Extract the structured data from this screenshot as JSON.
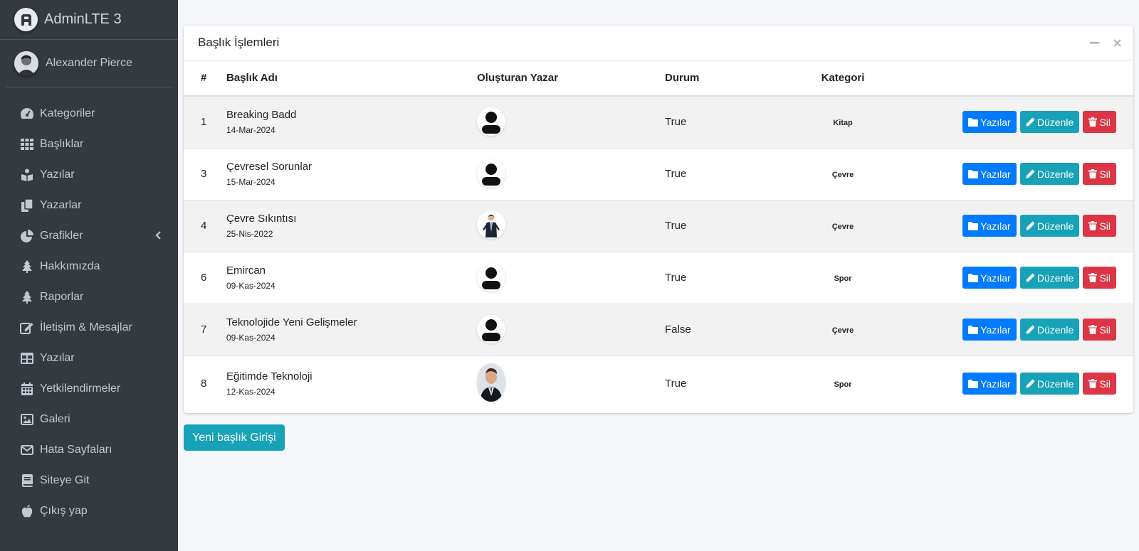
{
  "brand": {
    "name": "AdminLTE 3",
    "logo_icon": "adminlte-logo-icon"
  },
  "user": {
    "name": "Alexander Pierce",
    "avatar_icon": "user-avatar"
  },
  "sidebar": {
    "items": [
      {
        "label": "Kategoriler",
        "icon": "tachometer-icon"
      },
      {
        "label": "Başlıklar",
        "icon": "grid-icon"
      },
      {
        "label": "Yazılar",
        "icon": "book-reader-icon"
      },
      {
        "label": "Yazarlar",
        "icon": "copy-icon"
      },
      {
        "label": "Grafikler",
        "icon": "pie-chart-icon",
        "has_submenu": true
      },
      {
        "label": "Hakkımızda",
        "icon": "tree-icon"
      },
      {
        "label": "Raporlar",
        "icon": "tree-icon"
      },
      {
        "label": "İletişim & Mesajlar",
        "icon": "edit-icon"
      },
      {
        "label": "Yazılar",
        "icon": "table-icon"
      },
      {
        "label": "Yetkilendirmeler",
        "icon": "calendar-icon"
      },
      {
        "label": "Galeri",
        "icon": "image-icon"
      },
      {
        "label": "Hata Sayfaları",
        "icon": "envelope-icon"
      },
      {
        "label": "Siteye Git",
        "icon": "book-icon"
      },
      {
        "label": "Çıkış yap",
        "icon": "apple-icon"
      }
    ]
  },
  "card": {
    "title": "Başlık İşlemleri",
    "tools": {
      "collapse_icon": "minus-icon",
      "remove_icon": "times-icon"
    },
    "columns": [
      "#",
      "Başlık Adı",
      "Oluşturan Yazar",
      "Durum",
      "Kategori",
      ""
    ],
    "rows": [
      {
        "id": "1",
        "title": "Breaking Badd",
        "date": "14-Mar-2024",
        "author_avatar": "default-user-icon",
        "status": "True",
        "category": "Kitap"
      },
      {
        "id": "3",
        "title": "Çevresel Sorunlar",
        "date": "15-Mar-2024",
        "author_avatar": "default-user-icon",
        "status": "True",
        "category": "Çevre"
      },
      {
        "id": "4",
        "title": "Çevre Sıkıntısı",
        "date": "25-Nis-2022",
        "author_avatar": "businessman-photo",
        "status": "True",
        "category": "Çevre"
      },
      {
        "id": "6",
        "title": "Emircan",
        "date": "09-Kas-2024",
        "author_avatar": "default-user-icon",
        "status": "True",
        "category": "Spor"
      },
      {
        "id": "7",
        "title": "Teknolojide Yeni Gelişmeler",
        "date": "09-Kas-2024",
        "author_avatar": "default-user-icon",
        "status": "False",
        "category": "Çevre"
      },
      {
        "id": "8",
        "title": "Eğitimde Teknoloji",
        "date": "12-Kas-2024",
        "author_avatar": "man-portrait-photo",
        "status": "True",
        "category": "Spor"
      }
    ],
    "actions": {
      "posts_label": "Yazılar",
      "edit_label": "Düzenle",
      "delete_label": "Sil"
    }
  },
  "new_button": {
    "label": "Yeni başlık Girişi"
  },
  "colors": {
    "sidebar_bg": "#343a40",
    "primary": "#007bff",
    "info": "#17a2b8",
    "danger": "#dc3545",
    "page_bg": "#f4f6f9"
  }
}
